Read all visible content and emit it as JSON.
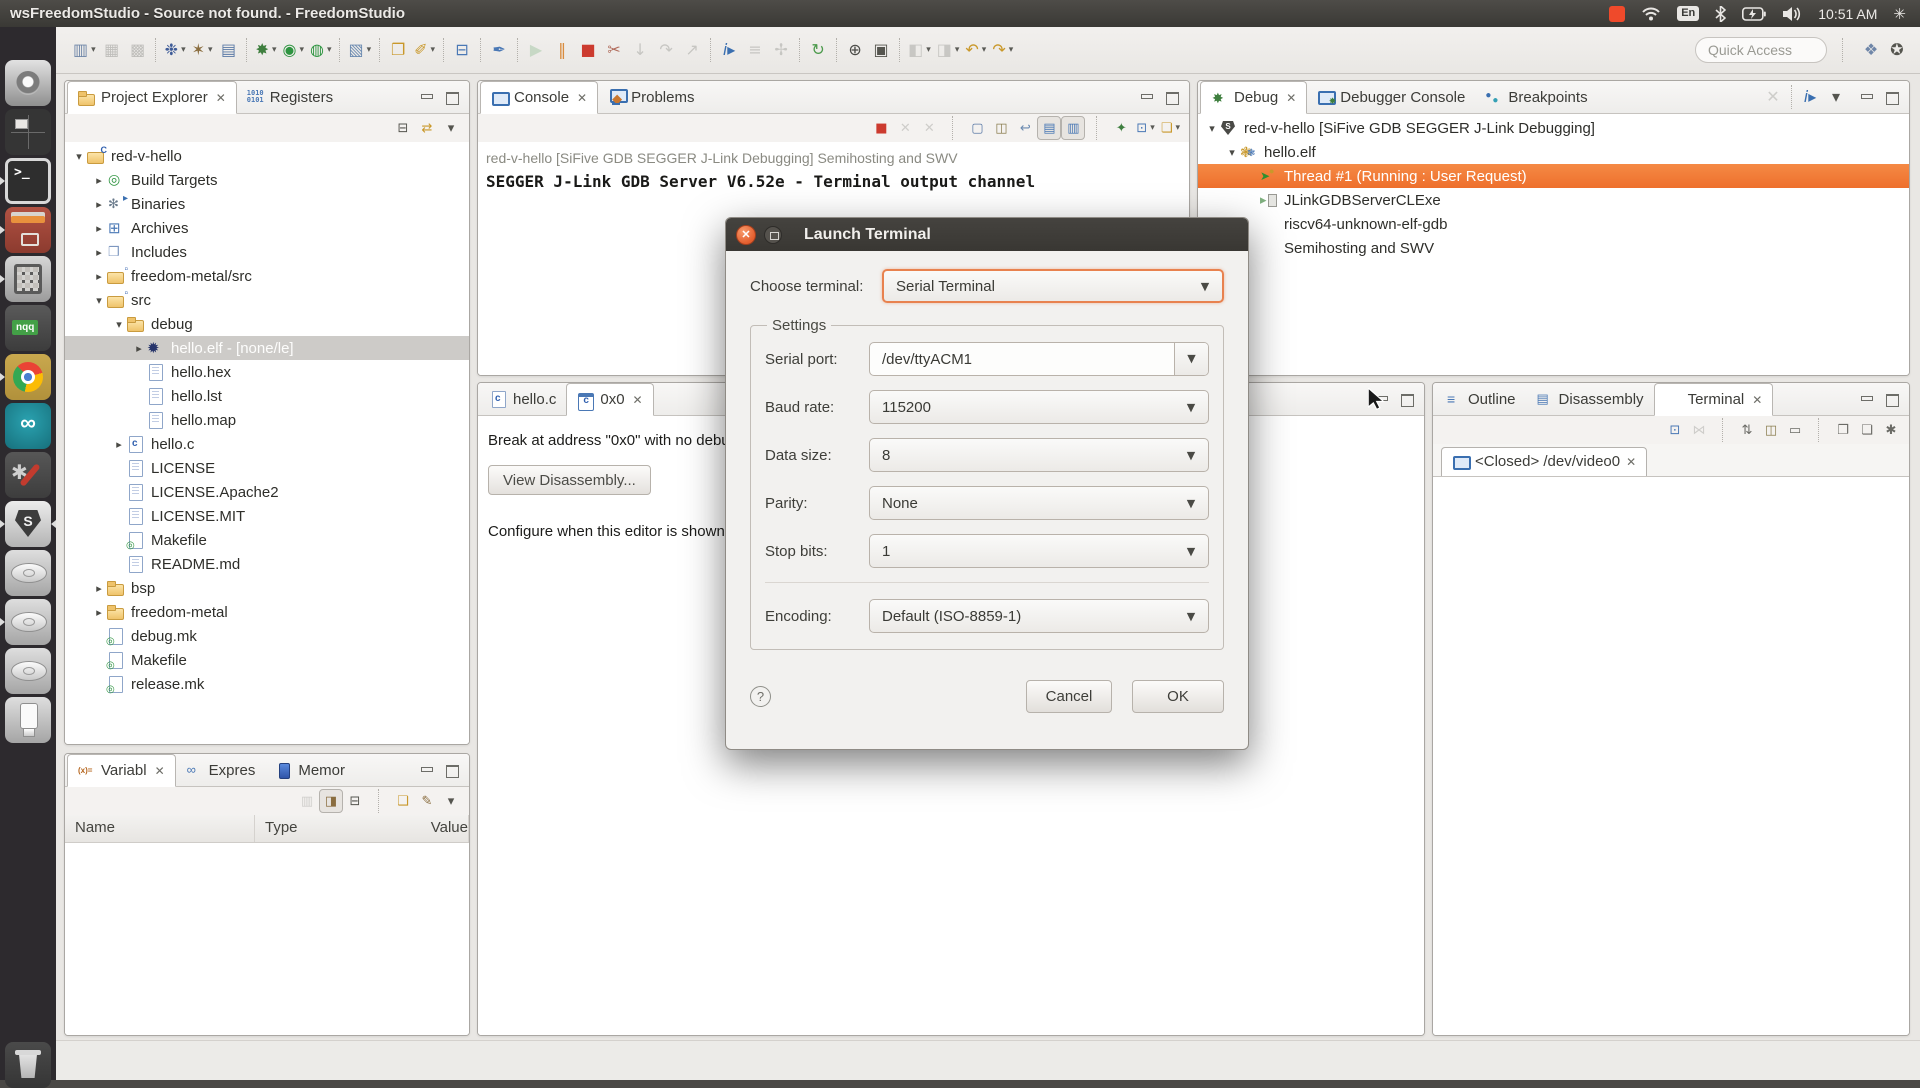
{
  "desktop": {
    "title": "wsFreedomStudio - Source not found. - FreedomStudio",
    "tray": {
      "keyboard": "En",
      "time": "10:51 AM"
    }
  },
  "launcher": {
    "items": [
      {
        "name": "ubuntu-dash-icon",
        "kind": "dash"
      },
      {
        "name": "workspace-switcher-icon",
        "kind": "workspace"
      },
      {
        "name": "terminal-icon",
        "kind": "terminal",
        "running": true
      },
      {
        "name": "archive-manager-icon",
        "kind": "archive",
        "running": true
      },
      {
        "name": "calculator-icon",
        "kind": "calc",
        "running": true
      },
      {
        "name": "notepadqq-icon",
        "kind": "nqq"
      },
      {
        "name": "chrome-icon",
        "kind": "chrome",
        "running": true
      },
      {
        "name": "arduino-icon",
        "kind": "arduino"
      },
      {
        "name": "system-tools-icon",
        "kind": "tools"
      },
      {
        "name": "freedomstudio-segger-icon",
        "kind": "segger",
        "running": true,
        "focused": true
      },
      {
        "name": "disk-1-icon",
        "kind": "disk"
      },
      {
        "name": "disk-2-icon",
        "kind": "disk",
        "running": true
      },
      {
        "name": "disk-3-icon",
        "kind": "disk"
      },
      {
        "name": "usb-drive-icon",
        "kind": "usb"
      },
      {
        "name": "trash-icon",
        "kind": "trash"
      }
    ]
  },
  "toolbar": {
    "quick_access": "Quick Access",
    "items": [
      {
        "name": "new-wizard-button",
        "g": "▥",
        "c": "#6f86a8",
        "dd": true
      },
      {
        "name": "save-button",
        "g": "▦",
        "c": "#9a9a96",
        "dis": true
      },
      {
        "name": "save-all-button",
        "g": "▩",
        "c": "#9a9a96",
        "dis": true
      },
      {
        "name": "toolbar-separator",
        "sep": true,
        "inter": "false"
      },
      {
        "name": "debug-config-button",
        "g": "❉",
        "c": "#3f5c98",
        "dd": true
      },
      {
        "name": "build-button",
        "g": "✶",
        "c": "#8a6d3f",
        "dd": true
      },
      {
        "name": "binary-file-button",
        "g": "▤",
        "c": "#5b7aa6"
      },
      {
        "name": "toolbar-separator",
        "sep": true,
        "inter": "false"
      },
      {
        "name": "debug-button",
        "g": "✸",
        "c": "#3f7f3f",
        "dd": true
      },
      {
        "name": "run-button",
        "g": "◉",
        "c": "#2e9440",
        "dd": true
      },
      {
        "name": "profile-button",
        "g": "◍",
        "c": "#2e9440",
        "dd": true
      },
      {
        "name": "toolbar-separator",
        "sep": true,
        "inter": "false"
      },
      {
        "name": "external-tools-button",
        "g": "▧",
        "c": "#6b8ab0",
        "dd": true
      },
      {
        "name": "toolbar-separator",
        "sep": true,
        "inter": "false"
      },
      {
        "name": "open-element-button",
        "g": "❐",
        "c": "#c9982a"
      },
      {
        "name": "mark-occurrences-button",
        "g": "✐",
        "c": "#c9982a",
        "dd": true
      },
      {
        "name": "toolbar-separator",
        "sep": true,
        "inter": "false"
      },
      {
        "name": "console-view-button",
        "g": "⊟",
        "c": "#4a78b5"
      },
      {
        "name": "toolbar-separator",
        "sep": true,
        "inter": "false"
      },
      {
        "name": "annotation-pen-button",
        "g": "✒",
        "c": "#4a78b5"
      },
      {
        "name": "toolbar-separator",
        "sep": true,
        "inter": "false"
      },
      {
        "name": "resume-button",
        "g": "▶",
        "c": "#a9c9a9",
        "dis": true
      },
      {
        "name": "suspend-button",
        "g": "‖",
        "c": "#d98c3f"
      },
      {
        "name": "terminate-button",
        "g": "■",
        "c": "#cc3b2f"
      },
      {
        "name": "disconnect-button",
        "g": "✂",
        "c": "#b06a5a"
      },
      {
        "name": "step-into-button",
        "g": "↓",
        "c": "#a8a8a4",
        "dis": true
      },
      {
        "name": "step-over-button",
        "g": "↷",
        "c": "#a8a8a4",
        "dis": true
      },
      {
        "name": "step-return-button",
        "g": "↗",
        "c": "#a8a8a4",
        "dis": true
      },
      {
        "name": "toolbar-separator",
        "sep": true,
        "inter": "false"
      },
      {
        "name": "instruction-stepping-button",
        "g": "i▸",
        "c": "#3a6fb0"
      },
      {
        "name": "show-full-paths-button",
        "g": "≡",
        "c": "#a8a8a4",
        "dis": true
      },
      {
        "name": "step-filters-button",
        "g": "✢",
        "c": "#a8a8a4",
        "dis": true
      },
      {
        "name": "toolbar-separator",
        "sep": true,
        "inter": "false"
      },
      {
        "name": "refresh-debug-button",
        "g": "↻",
        "c": "#4c9a4c"
      },
      {
        "name": "toolbar-separator",
        "sep": true,
        "inter": "false"
      },
      {
        "name": "reset-board-button",
        "g": "⊕",
        "c": "#4a4a46"
      },
      {
        "name": "memory-view-button",
        "g": "▣",
        "c": "#55554f"
      },
      {
        "name": "toolbar-separator",
        "sep": true,
        "inter": "false"
      },
      {
        "name": "trace-button",
        "g": "◧",
        "c": "#aaaaa6",
        "dis": true,
        "dd": true
      },
      {
        "name": "profiling-button",
        "g": "◨",
        "c": "#aaaaa6",
        "dis": true,
        "dd": true
      },
      {
        "name": "back-history-button",
        "g": "↶",
        "c": "#c9982a",
        "dd": true
      },
      {
        "name": "forward-history-button",
        "g": "↷",
        "c": "#c9982a",
        "dd": true
      }
    ],
    "perspective": [
      {
        "name": "open-perspective-button",
        "g": "❖",
        "c": "#6f86a8"
      },
      {
        "name": "debug-perspective-button",
        "g": "✪",
        "c": "#55554f"
      }
    ]
  },
  "project_explorer": {
    "tabs": [
      {
        "label": "Project Explorer",
        "icon": "pexplorer",
        "active": true,
        "close": true
      },
      {
        "label": "Registers",
        "icon": "registers"
      }
    ],
    "toolbar": [
      {
        "name": "collapse-all-button",
        "g": "⊟",
        "c": "#55554f"
      },
      {
        "name": "link-with-editor-button",
        "g": "⇄",
        "c": "#c9982a"
      },
      {
        "name": "view-menu-button",
        "g": "▾",
        "c": "#55554f"
      }
    ],
    "tree": [
      {
        "depth": 0,
        "expander": "open",
        "icon": "cproject",
        "label": "red-v-hello"
      },
      {
        "depth": 1,
        "expander": "closed",
        "icon": "target",
        "label": "Build Targets"
      },
      {
        "depth": 1,
        "expander": "closed",
        "icon": "binaries",
        "label": "Binaries"
      },
      {
        "depth": 1,
        "expander": "closed",
        "icon": "archives",
        "label": "Archives"
      },
      {
        "depth": 1,
        "expander": "closed",
        "icon": "includes",
        "label": "Includes"
      },
      {
        "depth": 1,
        "expander": "closed",
        "icon": "foldersrc",
        "label": "freedom-metal/src"
      },
      {
        "depth": 1,
        "expander": "open",
        "icon": "foldersrc",
        "label": "src"
      },
      {
        "depth": 2,
        "expander": "open",
        "icon": "folder",
        "label": "debug"
      },
      {
        "depth": 3,
        "expander": "closed",
        "icon": "elf",
        "label": "hello.elf - [none/le]",
        "selected": true
      },
      {
        "depth": 3,
        "expander": "none",
        "icon": "file",
        "label": "hello.hex"
      },
      {
        "depth": 3,
        "expander": "none",
        "icon": "file",
        "label": "hello.lst"
      },
      {
        "depth": 3,
        "expander": "none",
        "icon": "file",
        "label": "hello.map"
      },
      {
        "depth": 2,
        "expander": "closed",
        "icon": "cfile",
        "label": "hello.c"
      },
      {
        "depth": 2,
        "expander": "none",
        "icon": "file",
        "label": "LICENSE"
      },
      {
        "depth": 2,
        "expander": "none",
        "icon": "file",
        "label": "LICENSE.Apache2"
      },
      {
        "depth": 2,
        "expander": "none",
        "icon": "file",
        "label": "LICENSE.MIT"
      },
      {
        "depth": 2,
        "expander": "none",
        "icon": "make",
        "label": "Makefile"
      },
      {
        "depth": 2,
        "expander": "none",
        "icon": "file",
        "label": "README.md"
      },
      {
        "depth": 1,
        "expander": "closed",
        "icon": "folder",
        "label": "bsp"
      },
      {
        "depth": 1,
        "expander": "closed",
        "icon": "folder",
        "label": "freedom-metal"
      },
      {
        "depth": 1,
        "expander": "none",
        "icon": "make",
        "label": "debug.mk"
      },
      {
        "depth": 1,
        "expander": "none",
        "icon": "make",
        "label": "Makefile"
      },
      {
        "depth": 1,
        "expander": "none",
        "icon": "make",
        "label": "release.mk"
      }
    ]
  },
  "variables": {
    "tabs": [
      {
        "label": "Variabl",
        "icon": "vars",
        "active": true,
        "close": true
      },
      {
        "label": "Expres",
        "icon": "expr"
      },
      {
        "label": "Memor",
        "icon": "mem"
      }
    ],
    "toolbar": [
      {
        "name": "show-types-button",
        "g": "▥",
        "c": "#b0b0ac",
        "dis": true
      },
      {
        "name": "show-logical-structures-button",
        "g": "◨",
        "c": "#8a6d3f",
        "pressed": true
      },
      {
        "name": "collapse-all-button",
        "g": "⊟",
        "c": "#55554f"
      },
      {
        "name": "toolbar-separator",
        "sep": true,
        "inter": "false"
      },
      {
        "name": "new-expression-button",
        "g": "❑",
        "c": "#c9982a"
      },
      {
        "name": "edit-expression-button",
        "g": "✎",
        "c": "#8a6d3f"
      },
      {
        "name": "view-menu-button",
        "g": "▾",
        "c": "#55554f"
      }
    ],
    "columns": [
      "Name",
      "Type",
      "Value"
    ]
  },
  "console": {
    "tabs": [
      {
        "label": "Console",
        "icon": "console",
        "active": true,
        "close": true
      },
      {
        "label": "Problems",
        "icon": "problems"
      }
    ],
    "toolbar": [
      {
        "name": "terminate-console-button",
        "g": "■",
        "c": "#cc3b2f"
      },
      {
        "name": "remove-launch-button",
        "g": "✕",
        "c": "#b0b0ac",
        "dis": true
      },
      {
        "name": "remove-all-launches-button",
        "g": "✕",
        "c": "#b0b0ac",
        "dis": true
      },
      {
        "name": "toolbar-separator",
        "sep": true,
        "inter": "false"
      },
      {
        "name": "clear-console-button",
        "g": "▢",
        "c": "#5b7aa6"
      },
      {
        "name": "scroll-lock-button",
        "g": "◫",
        "c": "#8a7d4f"
      },
      {
        "name": "word-wrap-button",
        "g": "↩",
        "c": "#6b8ab0"
      },
      {
        "name": "show-stdout-button",
        "g": "▤",
        "c": "#4a78b5",
        "pressed": true
      },
      {
        "name": "show-stderr-button",
        "g": "▥",
        "c": "#4a78b5",
        "pressed": true
      },
      {
        "name": "toolbar-separator",
        "sep": true,
        "inter": "false"
      },
      {
        "name": "pin-console-button",
        "g": "✦",
        "c": "#3f7f3f"
      },
      {
        "name": "display-console-button",
        "g": "⊡",
        "c": "#4a78b5",
        "dd": true
      },
      {
        "name": "open-console-button",
        "g": "❏",
        "c": "#c9982a",
        "dd": true
      }
    ],
    "status_line": "red-v-hello [SiFive GDB SEGGER J-Link Debugging] Semihosting and SWV",
    "output_line": "SEGGER J-Link GDB Server V6.52e - Terminal output channel"
  },
  "debug": {
    "tabs": [
      {
        "label": "Debug",
        "icon": "debug",
        "active": true,
        "close": true
      },
      {
        "label": "Debugger Console",
        "icon": "dbgconsole"
      },
      {
        "label": "Breakpoints",
        "icon": "breakpoints"
      }
    ],
    "toolbar": [
      {
        "name": "remove-all-terminated-button",
        "g": "✕",
        "c": "#b0b0ac",
        "dis": true
      },
      {
        "name": "toolbar-separator",
        "sep": true,
        "inter": "false"
      },
      {
        "name": "instruction-stepping-toggle",
        "g": "i▸",
        "c": "#3a6fb0"
      },
      {
        "name": "view-menu-button",
        "g": "▾",
        "c": "#55554f"
      }
    ],
    "tree": [
      {
        "depth": 0,
        "expander": "open",
        "icon": "segger",
        "label": "red-v-hello [SiFive GDB SEGGER J-Link Debugging]"
      },
      {
        "depth": 1,
        "expander": "open",
        "icon": "exe",
        "label": "hello.elf"
      },
      {
        "depth": 2,
        "expander": "none",
        "icon": "thread",
        "label": "Thread #1 (Running : User Request)",
        "selected": true
      },
      {
        "depth": 2,
        "expander": "none",
        "icon": "proc",
        "label": "JLinkGDBServerCLExe"
      },
      {
        "depth": 2,
        "expander": "none",
        "icon": "none",
        "label": "riscv64-unknown-elf-gdb"
      },
      {
        "depth": 2,
        "expander": "none",
        "icon": "none",
        "label": "Semihosting and SWV"
      }
    ]
  },
  "editor": {
    "tabs": [
      {
        "label": "hello.c",
        "icon": "cfile"
      },
      {
        "label": "0x0",
        "icon": "cwin",
        "active": true,
        "close": true
      }
    ],
    "break_message": "Break at address \"0x0\" with no debug information available, or outside of program code.",
    "view_disassembly_label": "View Disassembly...",
    "configure_message": "Configure when this editor is shown"
  },
  "right_panel": {
    "tabs": [
      {
        "label": "Outline",
        "icon": "outline"
      },
      {
        "label": "Disassembly",
        "icon": "disasm"
      },
      {
        "label": "Terminal",
        "icon": "terminal",
        "active": true,
        "close": true
      }
    ],
    "toolbar": [
      {
        "name": "connect-terminal-button",
        "g": "⊡",
        "c": "#4a78b5"
      },
      {
        "name": "disconnect-terminal-button",
        "g": "⋈",
        "c": "#b0b0ac",
        "dis": true
      },
      {
        "name": "toolbar-separator",
        "sep": true,
        "inter": "false"
      },
      {
        "name": "pin-terminal-button",
        "g": "⇅",
        "c": "#6b6b66"
      },
      {
        "name": "scroll-lock-button",
        "g": "◫",
        "c": "#8a7d4f"
      },
      {
        "name": "command-input-button",
        "g": "▭",
        "c": "#6b6b66"
      },
      {
        "name": "toolbar-separator",
        "sep": true,
        "inter": "false"
      },
      {
        "name": "copy-button",
        "g": "❐",
        "c": "#6b6b66"
      },
      {
        "name": "paste-button",
        "g": "❏",
        "c": "#6b6b66"
      },
      {
        "name": "terminal-settings-button",
        "g": "✱",
        "c": "#6b6b66"
      }
    ],
    "inner_tab_label": "<Closed> /dev/video0"
  },
  "dialog": {
    "title": "Launch Terminal",
    "choose_label": "Choose terminal:",
    "choose_value": "Serial Terminal",
    "group_label": "Settings",
    "rows": [
      {
        "label": "Serial port:",
        "value": "/dev/ttyACM1",
        "editable": true
      },
      {
        "label": "Baud rate:",
        "value": "115200"
      },
      {
        "label": "Data size:",
        "value": "8"
      },
      {
        "label": "Parity:",
        "value": "None"
      },
      {
        "label": "Stop bits:",
        "value": "1"
      }
    ],
    "encoding_label": "Encoding:",
    "encoding_value": "Default (ISO-8859-1)",
    "help_label": "?",
    "cancel_label": "Cancel",
    "ok_label": "OK"
  }
}
